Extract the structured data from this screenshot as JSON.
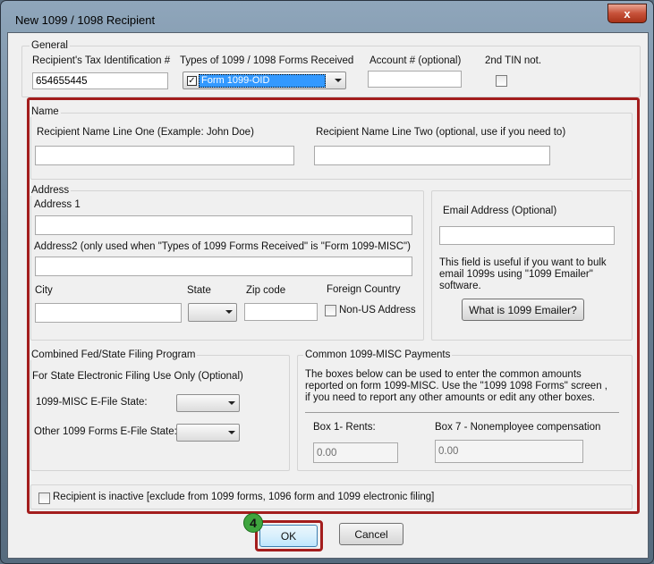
{
  "window": {
    "title": "New 1099 / 1098 Recipient",
    "close_label": "x"
  },
  "general": {
    "group_label": "General",
    "tin_label": "Recipient's Tax Identification #",
    "tin_value": "654655445",
    "form_type_label": "Types of 1099 / 1098 Forms Received",
    "form_type_value": "Form 1099-OID",
    "account_label": "Account # (optional)",
    "account_value": "",
    "second_tin_label": "2nd TIN not."
  },
  "name": {
    "group_label": "Name",
    "line1_label": "Recipient Name Line One (Example: John Doe)",
    "line2_label": "Recipient Name Line Two (optional, use if you need to)"
  },
  "address": {
    "group_label": "Address",
    "address1_label": "Address 1",
    "address2_label": "Address2 (only used when \"Types of 1099 Forms Received\" is \"Form 1099-MISC\")",
    "city_label": "City",
    "state_label": "State",
    "zip_label": "Zip code",
    "foreign_label": "Foreign Country",
    "non_us_label": "Non-US Address"
  },
  "email": {
    "label": "Email Address (Optional)",
    "help_text": "This field is useful if you want to bulk email 1099s using \"1099 Emailer\" software.",
    "button_label": "What is 1099 Emailer?"
  },
  "state_filing": {
    "group_label": "Combined Fed/State Filing Program",
    "subtitle": "For State Electronic Filing Use Only (Optional)",
    "misc_label": "1099-MISC E-File State:",
    "other_label": "Other 1099 Forms E-File State:"
  },
  "payments": {
    "group_label": "Common 1099-MISC Payments",
    "description": "The boxes below can be used to enter the common amounts reported on form 1099-MISC. Use the \"1099  1098 Forms\" screen , if you need to report any other amounts or edit any other boxes.",
    "box1_label": "Box 1- Rents:",
    "box1_value": "0.00",
    "box7_label": "Box 7 - Nonemployee compensation",
    "box7_value": "0.00"
  },
  "inactive_label": "Recipient is inactive [exclude from 1099 forms, 1096 form and 1099 electronic filing]",
  "buttons": {
    "ok": "OK",
    "cancel": "Cancel"
  },
  "step_badge": "4",
  "colors": {
    "highlight": "#a31d1d",
    "badge": "#3ea53e",
    "selection": "#3399ff"
  }
}
